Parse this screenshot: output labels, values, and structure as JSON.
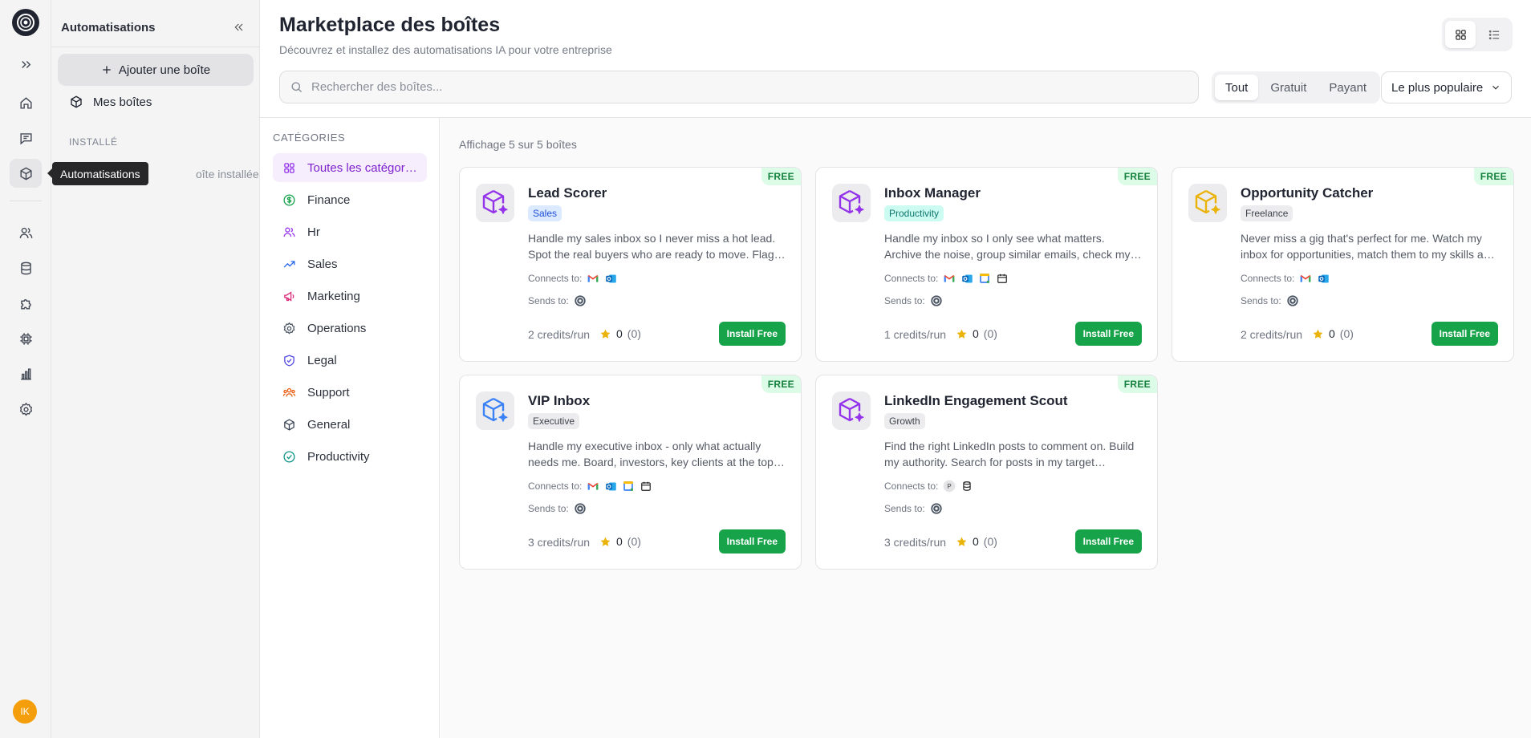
{
  "sidebar_panel": {
    "title": "Automatisations",
    "add_label": "Ajouter une boîte",
    "my_boxes": "Mes boîtes",
    "installed_heading": "INSTALLÉ",
    "installed_empty": "oîte installée"
  },
  "tooltip": "Automatisations",
  "user": {
    "initials": "IK"
  },
  "header": {
    "title": "Marketplace des boîtes",
    "subtitle": "Découvrez et installez des automatisations IA pour votre entreprise",
    "search_placeholder": "Rechercher des boîtes...",
    "filters": [
      "Tout",
      "Gratuit",
      "Payant"
    ],
    "sort": "Le plus populaire"
  },
  "categories": {
    "heading": "CATÉGORIES",
    "items": [
      {
        "label": "Toutes les catégories",
        "color": "#9333ea"
      },
      {
        "label": "Finance",
        "color": "#16a34a"
      },
      {
        "label": "Hr",
        "color": "#9333ea"
      },
      {
        "label": "Sales",
        "color": "#2563eb"
      },
      {
        "label": "Marketing",
        "color": "#db2777"
      },
      {
        "label": "Operations",
        "color": "#4b5563"
      },
      {
        "label": "Legal",
        "color": "#4f46e5"
      },
      {
        "label": "Support",
        "color": "#ea580c"
      },
      {
        "label": "General",
        "color": "#374151"
      },
      {
        "label": "Productivity",
        "color": "#0d9488"
      }
    ]
  },
  "content": {
    "count": "Affichage 5 sur 5 boîtes",
    "labels": {
      "free": "FREE",
      "connects": "Connects to:",
      "sends": "Sends to:",
      "install": "Install Free"
    },
    "cards": [
      {
        "name": "Lead Scorer",
        "badge": "Sales",
        "badge_bg": "#dbeafe",
        "badge_fg": "#1d4ed8",
        "icon_color": "#9333ea",
        "desc": "Handle my sales inbox so I never miss a hot lead. Spot the real buyers who are ready to move. Flag deals that are slipping.",
        "connects": [
          "gmail-icon",
          "outlook-icon"
        ],
        "credits": "2 credits/run",
        "rating": "0",
        "reviews": "(0)"
      },
      {
        "name": "Inbox Manager",
        "badge": "Productivity",
        "badge_bg": "#ccfbf1",
        "badge_fg": "#0f766e",
        "icon_color": "#9333ea",
        "desc": "Handle my inbox so I only see what matters. Archive the noise, group similar emails, check my calendar.",
        "connects": [
          "gmail-icon",
          "outlook-icon",
          "google-calendar-icon",
          "calendar-icon"
        ],
        "credits": "1 credits/run",
        "rating": "0",
        "reviews": "(0)"
      },
      {
        "name": "Opportunity Catcher",
        "badge": "Freelance",
        "badge_bg": "#ececef",
        "badge_fg": "#3f434d",
        "icon_color": "#eab308",
        "desc": "Never miss a gig that's perfect for me. Watch my inbox for opportunities, match them to my skills and rates.",
        "connects": [
          "gmail-icon",
          "outlook-icon"
        ],
        "credits": "2 credits/run",
        "rating": "0",
        "reviews": "(0)"
      },
      {
        "name": "VIP Inbox",
        "badge": "Executive",
        "badge_bg": "#ececef",
        "badge_fg": "#3f434d",
        "icon_color": "#3b82f6",
        "desc": "Handle my executive inbox - only what actually needs me. Board, investors, key clients at the top of the list.",
        "connects": [
          "gmail-icon",
          "outlook-icon",
          "google-calendar-icon",
          "calendar-icon"
        ],
        "credits": "3 credits/run",
        "rating": "0",
        "reviews": "(0)"
      },
      {
        "name": "LinkedIn Engagement Scout",
        "badge": "Growth",
        "badge_bg": "#ececef",
        "badge_fg": "#3f434d",
        "icon_color": "#9333ea",
        "desc": "Find the right LinkedIn posts to comment on. Build my authority. Search for posts in my target audience.",
        "connects": [
          "p-icon",
          "database-icon"
        ],
        "credits": "3 credits/run",
        "rating": "0",
        "reviews": "(0)"
      }
    ]
  }
}
